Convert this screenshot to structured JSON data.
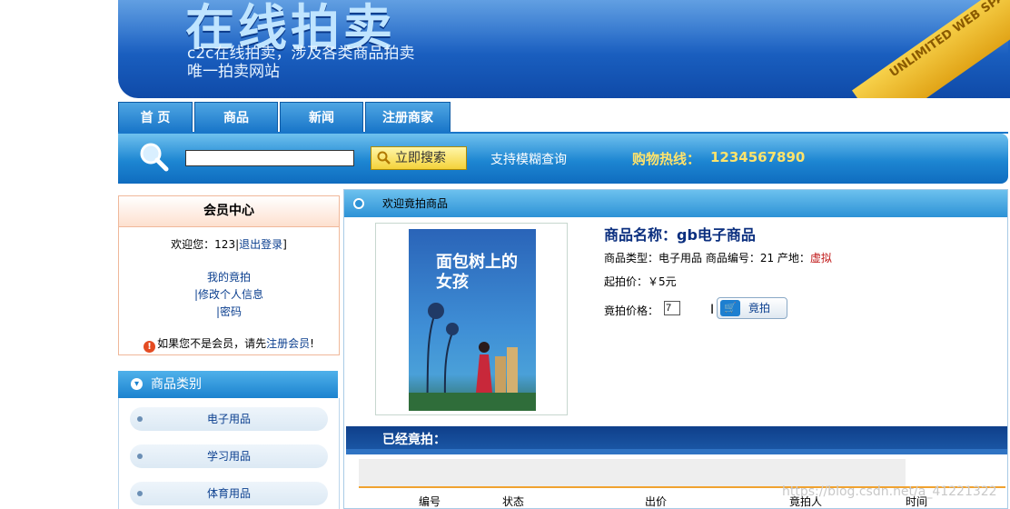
{
  "banner": {
    "title": "在线拍卖",
    "subtitle1": "c2c在线拍卖，涉及各类商品拍卖",
    "subtitle2": "唯一拍卖网站",
    "ribbon": "UNLIMITED WEB SPACE"
  },
  "nav": {
    "items": [
      "首 页",
      "商品",
      "新闻",
      "注册商家"
    ]
  },
  "search": {
    "value": "",
    "button_label": "立即搜索",
    "fuzzy_text": "支持模糊查询",
    "hotline_label": "购物热线：",
    "hotline_number": "1234567890"
  },
  "member": {
    "title": "会员中心",
    "welcome_prefix": "欢迎您：123|",
    "logout": "退出登录",
    "welcome_suffix": "]",
    "links": [
      "我的竟拍",
      "|修改个人信息",
      "|密码"
    ],
    "note_prefix": "如果您不是会员，请先",
    "note_link": "注册会员",
    "note_suffix": "!"
  },
  "categories": {
    "title": "商品类别",
    "items": [
      "电子用品",
      "学习用品",
      "体育用品"
    ]
  },
  "main": {
    "header": "欢迎竟拍商品",
    "book_title": "面包树上的女孩",
    "product_name": "商品名称：gb电子商品",
    "type_label": "商品类型：电子用品 商品编号：21 产地：",
    "origin": "虚拟",
    "start_price": "起拍价：￥5元",
    "bid_label": "竟拍价格：",
    "bid_value": "7",
    "bid_button": "竟拍",
    "bidded_title": "已经竟拍：",
    "columns": [
      "编号",
      "状态",
      "出价",
      "竟拍人",
      "时间"
    ],
    "watermark": "https://blog.csdn.net/a_41221322"
  }
}
